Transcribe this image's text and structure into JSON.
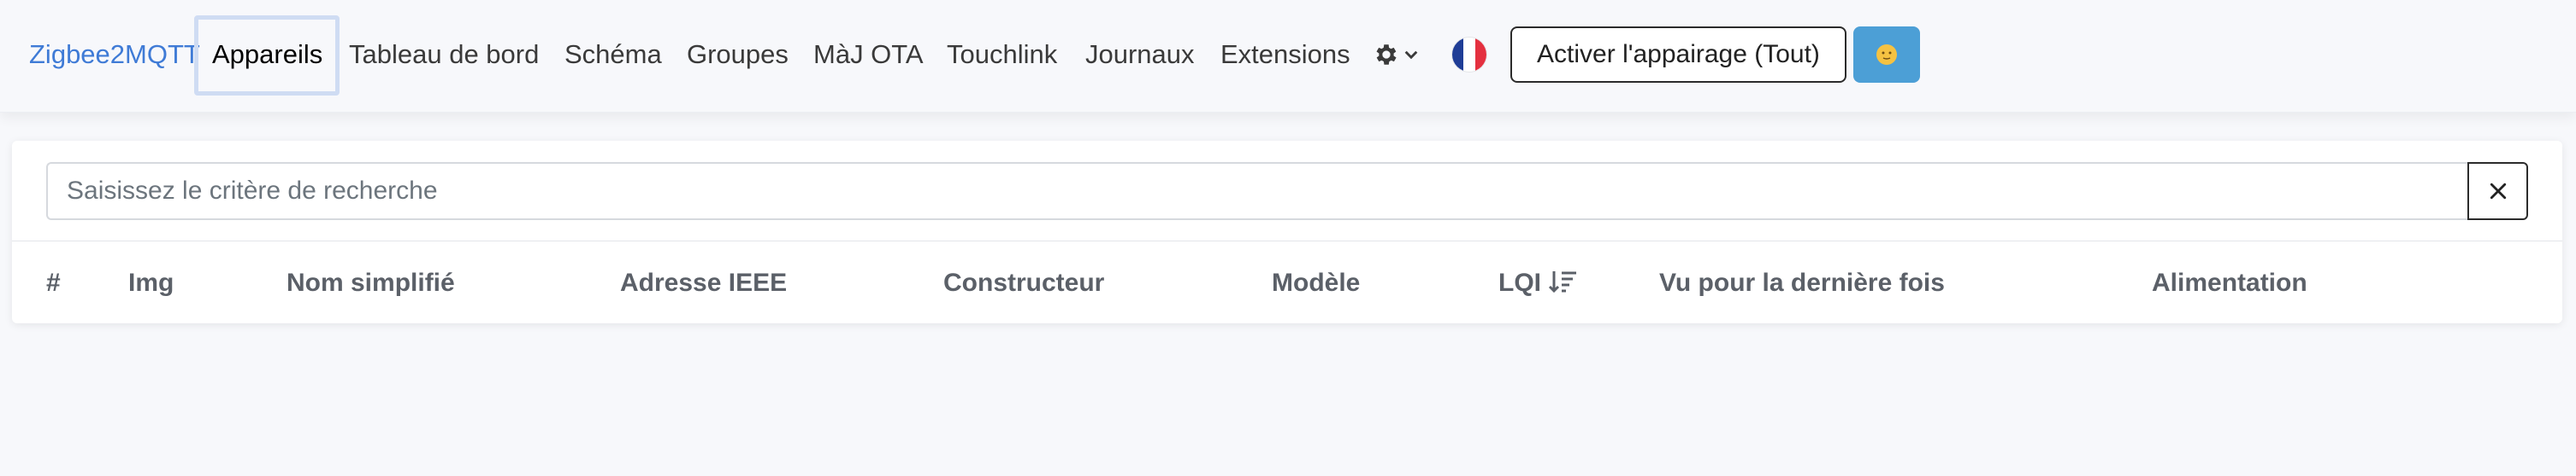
{
  "navbar": {
    "brand": "Zigbee2MQTT",
    "items": [
      {
        "label": "Appareils",
        "active": true
      },
      {
        "label": "Tableau de bord"
      },
      {
        "label": "Schéma"
      },
      {
        "label": "Groupes"
      },
      {
        "label": "MàJ OTA"
      },
      {
        "label": "Touchlink"
      },
      {
        "label": "Journaux"
      },
      {
        "label": "Extensions"
      }
    ],
    "settings_icon": "gear-icon",
    "language_icon": "french-flag-icon",
    "pair_button_label": "Activer l'appairage (Tout)",
    "theme_icon": "moon-face-icon",
    "colors": {
      "brand": "#3f7bd6",
      "theme_button": "#4c9fd6",
      "active_outline": "#cfdcf3"
    }
  },
  "search": {
    "placeholder": "Saisissez le critère de recherche",
    "value": "",
    "clear_icon": "close-icon"
  },
  "table": {
    "columns": [
      {
        "label": "#"
      },
      {
        "label": "Img"
      },
      {
        "label": "Nom simplifié"
      },
      {
        "label": "Adresse IEEE"
      },
      {
        "label": "Constructeur"
      },
      {
        "label": "Modèle"
      },
      {
        "label": "LQI",
        "sort_icon": "sort-descending-icon"
      },
      {
        "label": "Vu pour la dernière fois"
      },
      {
        "label": "Alimentation"
      }
    ],
    "rows": []
  }
}
